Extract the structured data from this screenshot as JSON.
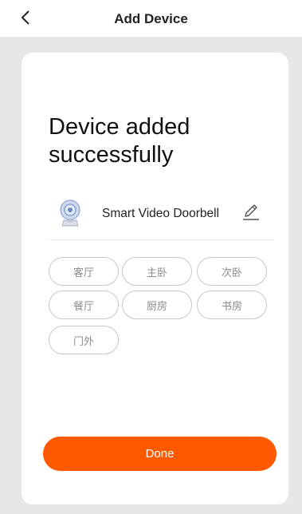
{
  "header": {
    "title": "Add Device",
    "back_icon": "chevron-left-icon"
  },
  "main": {
    "headline": "Device added successfully",
    "device": {
      "icon": "camera-icon",
      "name": "Smart Video Doorbell",
      "edit_icon": "pencil-icon"
    },
    "rooms": [
      "客厅",
      "主卧",
      "次卧",
      "餐厅",
      "厨房",
      "书房",
      "门外"
    ],
    "done_label": "Done"
  },
  "colors": {
    "accent": "#ff5a00",
    "background": "#e7e7e7",
    "card": "#ffffff",
    "chip_border": "#c8c8c8",
    "chip_text": "#8c8c8c"
  }
}
